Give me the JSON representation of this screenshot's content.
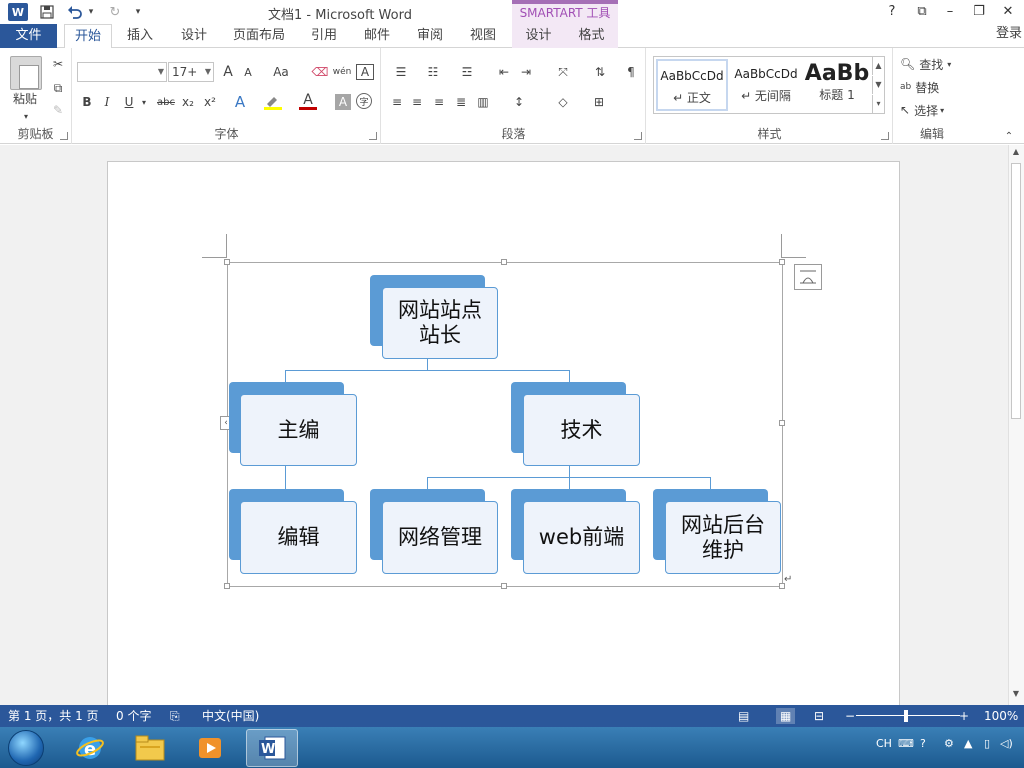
{
  "titlebar": {
    "doc_title": "文档1 - Microsoft Word",
    "context_tool": "SMARTART 工具",
    "help": "?",
    "restore_ribbon": "⧉",
    "minimize": "–",
    "maximize": "❐",
    "close": "✕",
    "undo_dd": "▾",
    "redo": "↻",
    "customize": "▾"
  },
  "tabs": {
    "file": "文件",
    "items": [
      "开始",
      "插入",
      "设计",
      "页面布局",
      "引用",
      "邮件",
      "审阅",
      "视图",
      "设计",
      "格式"
    ],
    "login": "登录"
  },
  "ribbon": {
    "clipboard": {
      "label": "剪贴板",
      "paste": "粘贴"
    },
    "font": {
      "label": "字体",
      "font_name": "",
      "font_size": "17+",
      "grow": "A",
      "shrink": "A",
      "change_case": "Aa",
      "bold": "B",
      "italic": "I",
      "underline": "U",
      "strike": "abc",
      "subscript": "x₂",
      "superscript": "x²",
      "font_color": "A",
      "char_shading": "A",
      "text_effect": "A",
      "phonetic": "wén",
      "char_border": "A",
      "enclose": "字"
    },
    "paragraph": {
      "label": "段落"
    },
    "styles": {
      "label": "样式",
      "items": [
        {
          "sample": "AaBbCcDd",
          "name": "↵ 正文"
        },
        {
          "sample": "AaBbCcDd",
          "name": "↵ 无间隔"
        },
        {
          "sample": "AaBb",
          "name": "标题 1"
        }
      ]
    },
    "editing": {
      "label": "编辑",
      "find": "查找",
      "replace": "替换",
      "select": "选择"
    }
  },
  "smartart": {
    "nodes": {
      "root": "网站站点\n站长",
      "editor": "主编",
      "tech": "技术",
      "editing": "编辑",
      "network": "网络管理",
      "web": "web前端",
      "backend": "网站后台\n维护"
    }
  },
  "statusbar": {
    "page": "第 1 页，共 1 页",
    "words": "0 个字",
    "language": "中文(中国)",
    "zoom": "100%",
    "zoom_minus": "−",
    "zoom_plus": "+"
  },
  "taskbar": {
    "tray_lang": "CH"
  }
}
